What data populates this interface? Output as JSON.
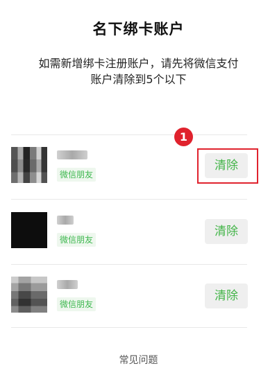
{
  "header": {
    "title": "名下绑卡账户",
    "description_line1": "如需新增绑卡注册账户，请先将微信支付",
    "description_line2": "账户清除到5个以下"
  },
  "accounts": [
    {
      "tag": "微信朋友",
      "clear_label": "清除"
    },
    {
      "tag": "微信朋友",
      "clear_label": "清除"
    },
    {
      "tag": "微信朋友",
      "clear_label": "清除"
    }
  ],
  "annotation": {
    "badge_number": "1",
    "color": "#e0222d"
  },
  "footer": {
    "faq_label": "常见问题"
  },
  "colors": {
    "accent_green": "#44b549",
    "tag_bg": "#eef7ee",
    "button_bg": "#efefef"
  }
}
